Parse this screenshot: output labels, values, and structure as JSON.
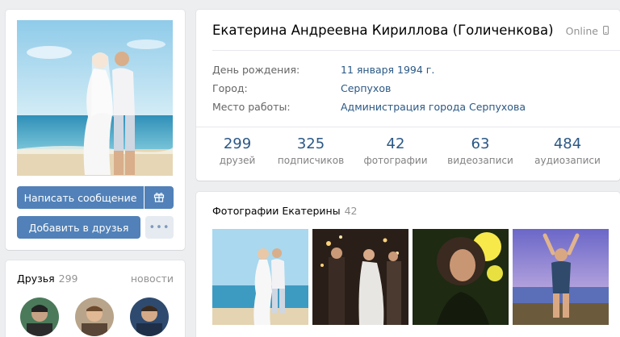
{
  "profile": {
    "name": "Екатерина Андреевна Кириллова (Голиченкова)",
    "status": "Online",
    "info": [
      {
        "label": "День рождения:",
        "value": "11 января 1994 г."
      },
      {
        "label": "Город:",
        "value": "Серпухов"
      },
      {
        "label": "Место работы:",
        "value": "Администрация города Серпухова"
      }
    ],
    "counters": [
      {
        "value": "299",
        "label": "друзей"
      },
      {
        "value": "325",
        "label": "подписчиков"
      },
      {
        "value": "42",
        "label": "фотографии"
      },
      {
        "value": "63",
        "label": "видеозаписи"
      },
      {
        "value": "484",
        "label": "аудиозаписи"
      }
    ]
  },
  "actions": {
    "message_label": "Написать сообщение",
    "add_friend_label": "Добавить в друзья",
    "more_label": "•••",
    "gift_icon": "gift-icon"
  },
  "friends": {
    "title": "Друзья",
    "count": "299",
    "news_link": "новости"
  },
  "photos": {
    "title": "Фотографии Екатерины",
    "count": "42"
  },
  "colors": {
    "accent": "#5181b8",
    "link": "#2a5885",
    "background": "#edeef0"
  }
}
